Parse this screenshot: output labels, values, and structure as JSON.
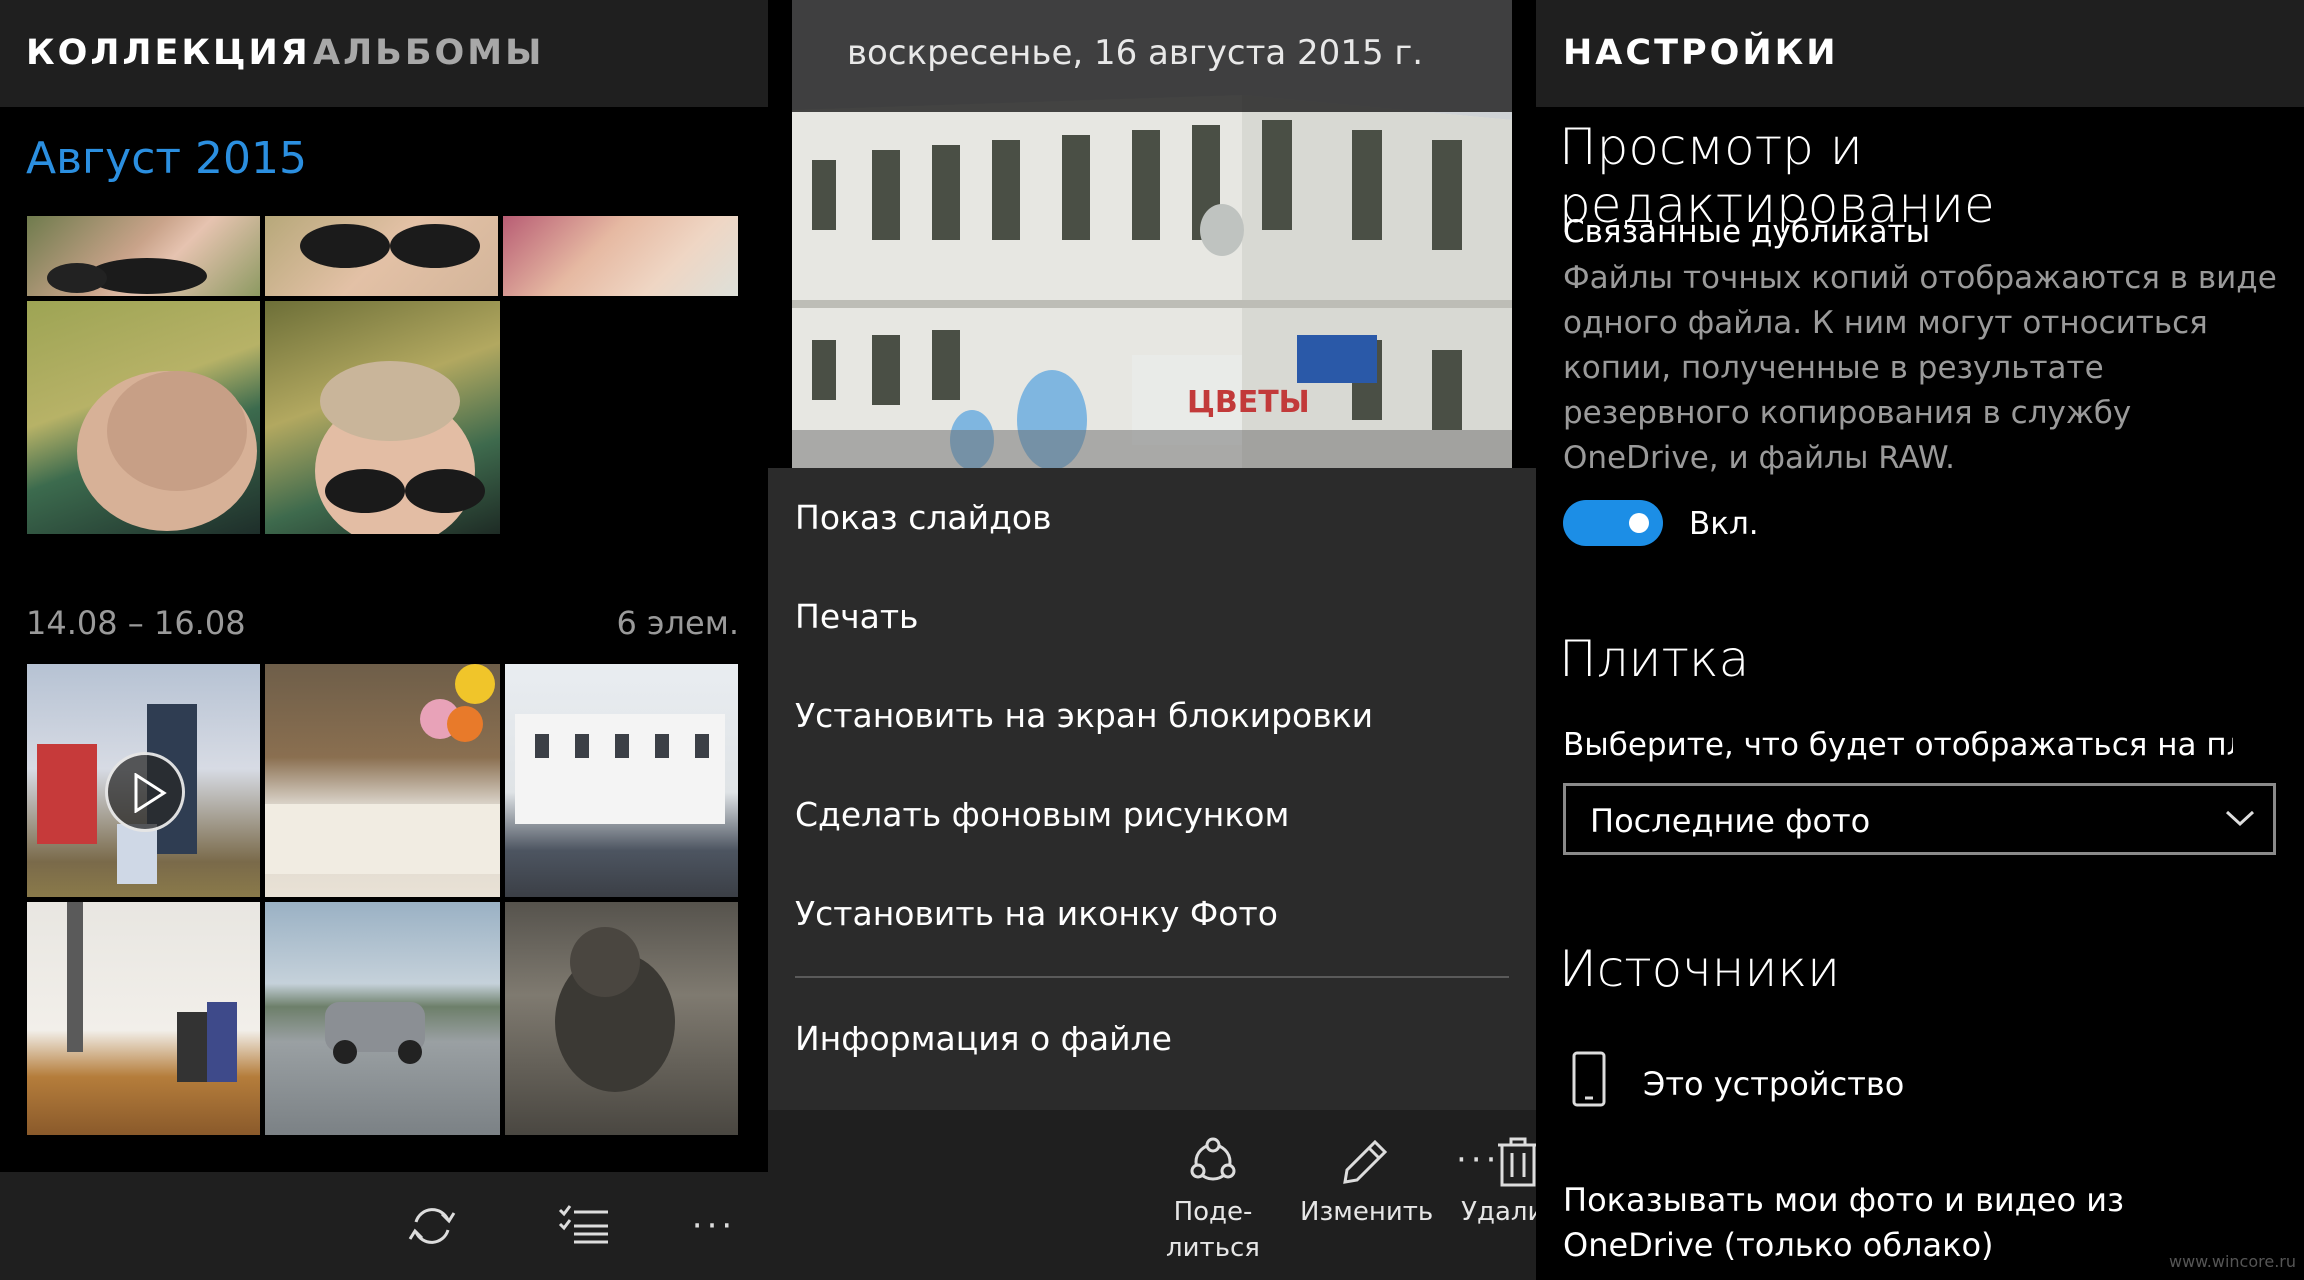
{
  "collection": {
    "tabs": [
      "КОЛЛЕКЦИЯ",
      "АЛЬБОМЫ"
    ],
    "month_heading": "Август 2015",
    "group_range": "14.08 – 16.08",
    "group_count": "6 элем.",
    "bottom_icons": [
      "sync-icon",
      "select-list-icon",
      "more-icon"
    ],
    "more_label": "···"
  },
  "viewer": {
    "date": "воскресенье, 16 августа 2015 г.",
    "photo_sign": "ЦВЕТЫ",
    "menu": [
      "Показ слайдов",
      "Печать",
      "Установить на экран блокировки",
      "Сделать фоновым рисунком",
      "Установить на иконку Фото",
      "Информация о файле"
    ],
    "commands": {
      "share_line1": "Поде-",
      "share_line2": "литься",
      "edit": "Изменить",
      "delete": "Удалить"
    },
    "more_label": "···"
  },
  "settings": {
    "title": "НАСТРОЙКИ",
    "section_view": "Просмотр и редактирование",
    "duplicates_label": "Связанные дубликаты",
    "duplicates_desc": "Файлы точных копий отображаются в виде одного файла. К ним могут относиться копии, полученные в результате резервного копирования в службу OneDrive, и файлы RAW.",
    "toggle_state": "Вкл.",
    "section_tile": "Плитка",
    "tile_label": "Выберите, что будет отображаться на плитке",
    "tile_value": "Последние фото",
    "section_sources": "Источники",
    "device_label": "Это устройство",
    "onedrive_text": "Показывать мои фото и видео из OneDrive (только облако)",
    "watermark": "www.wincore.ru"
  },
  "colors": {
    "accent": "#2b8fe0",
    "toggle_on": "#1c8ee6",
    "bar_bg": "#1f1f1f",
    "menu_bg": "#2b2b2b"
  }
}
